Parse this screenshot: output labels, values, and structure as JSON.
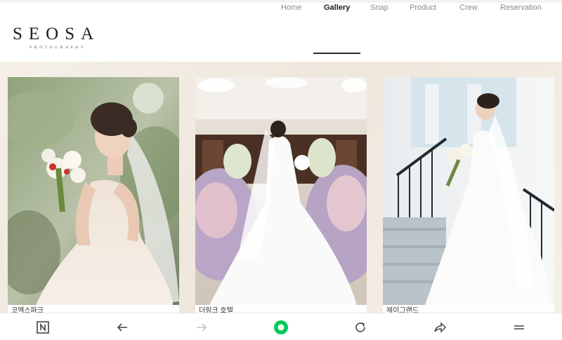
{
  "brand": {
    "name": "SEOSA",
    "tagline": "PHOTOGRAPHY"
  },
  "nav": {
    "items": [
      {
        "label": "Home",
        "active": false
      },
      {
        "label": "Gallery",
        "active": true
      },
      {
        "label": "Snap",
        "active": false
      },
      {
        "label": "Product",
        "active": false
      },
      {
        "label": "Crew",
        "active": false
      },
      {
        "label": "Reservation",
        "active": false
      }
    ]
  },
  "gallery": {
    "cards": [
      {
        "caption": "코엑스파크"
      },
      {
        "caption": "더링크 호텔"
      },
      {
        "caption": "제이그랜드"
      }
    ]
  },
  "browser_bar": {
    "icons": [
      "naver-n-icon",
      "back-arrow-icon",
      "forward-arrow-icon",
      "home-circle-icon",
      "refresh-icon",
      "share-icon",
      "menu-icon"
    ],
    "accent_color": "#03c75a"
  },
  "colors": {
    "background": "#f3eee7",
    "header": "#ffffff",
    "nav_active": "#1f1f1f",
    "nav_inactive": "#8a8a8a"
  }
}
